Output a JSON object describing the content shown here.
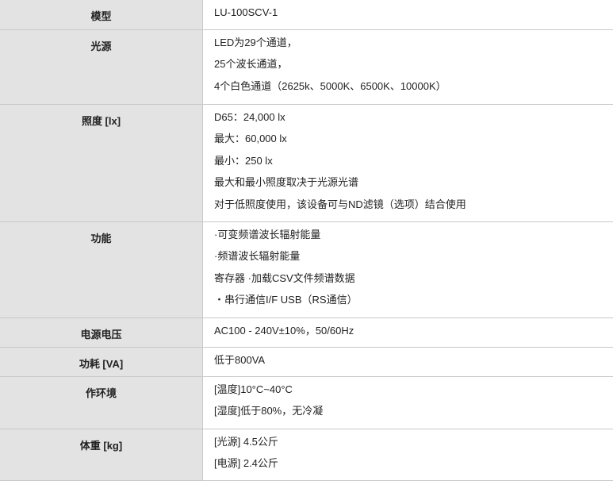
{
  "rows": [
    {
      "label": "模型",
      "lines": [
        "LU-100SCV-1"
      ]
    },
    {
      "label": "光源",
      "lines": [
        "LED为29个通道，",
        "25个波长通道，",
        "4个白色通道（2625k、5000K、6500K、10000K）"
      ]
    },
    {
      "label": "照度 [lx]",
      "lines": [
        "D65：24,000 lx",
        "最大：60,000 lx",
        "最小：250 lx",
        "最大和最小照度取决于光源光谱",
        "对于低照度使用，该设备可与ND滤镜（选项）结合使用"
      ]
    },
    {
      "label": "功能",
      "lines": [
        "·可变频谱波长辐射能量",
        "·频谱波长辐射能量",
        "寄存器 ·加载CSV文件频谱数据",
        "・串行通信I/F USB（RS通信）"
      ]
    },
    {
      "label": "电源电压",
      "lines": [
        "AC100 - 240V±10%，50/60Hz"
      ]
    },
    {
      "label": "功耗 [VA]",
      "lines": [
        "低于800VA"
      ]
    },
    {
      "label": "作环境",
      "lines": [
        "[温度]10°C~40°C",
        "[湿度]低于80%，无冷凝"
      ]
    },
    {
      "label": "体重 [kg]",
      "lines": [
        "[光源] 4.5公斤",
        "[电源] 2.4公斤"
      ]
    }
  ]
}
